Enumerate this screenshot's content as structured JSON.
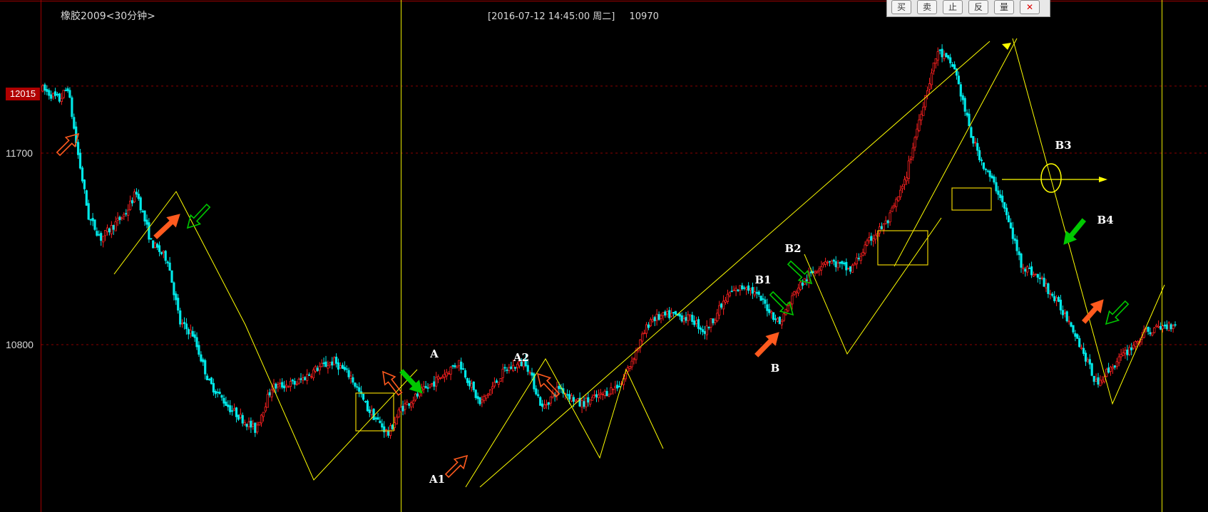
{
  "header": {
    "title": "橡胶2009<30分钟>",
    "datetime": "[2016-07-12  14:45:00 周二]",
    "price": "10970"
  },
  "toolbar": {
    "buttons": [
      {
        "label": "买",
        "icon": "buy-button"
      },
      {
        "label": "卖",
        "icon": "sell-button"
      },
      {
        "label": "止",
        "icon": "stop-button"
      },
      {
        "label": "反",
        "icon": "reverse-button"
      },
      {
        "label": "量",
        "icon": "volume-button"
      },
      {
        "label": "✕",
        "icon": "close-icon"
      }
    ]
  },
  "price_tag": "12015",
  "y_axis_labels": [
    "11700",
    "10800"
  ],
  "colors": {
    "up": "#ff2020",
    "down": "#00e8e8",
    "trend": "#ffff00",
    "grid": "#8b0000",
    "green_arrow": "#00c800",
    "orange_arrow": "#ff5a1e"
  },
  "chart_data": {
    "type": "candlestick",
    "symbol": "橡胶2009",
    "interval": "30分钟",
    "ylim": [
      10200,
      12400
    ],
    "price_levels": [
      12015,
      11700,
      10800
    ],
    "approx_close_path": [
      [
        0,
        12000
      ],
      [
        8,
        11950
      ],
      [
        12,
        12010
      ],
      [
        16,
        11750
      ],
      [
        22,
        11400
      ],
      [
        28,
        11300
      ],
      [
        40,
        11420
      ],
      [
        45,
        11520
      ],
      [
        52,
        11280
      ],
      [
        60,
        11200
      ],
      [
        66,
        10900
      ],
      [
        72,
        10850
      ],
      [
        80,
        10620
      ],
      [
        90,
        10500
      ],
      [
        102,
        10400
      ],
      [
        110,
        10600
      ],
      [
        122,
        10620
      ],
      [
        132,
        10690
      ],
      [
        140,
        10720
      ],
      [
        148,
        10650
      ],
      [
        156,
        10500
      ],
      [
        166,
        10380
      ],
      [
        172,
        10500
      ],
      [
        185,
        10600
      ],
      [
        195,
        10680
      ],
      [
        200,
        10720
      ],
      [
        210,
        10520
      ],
      [
        222,
        10680
      ],
      [
        232,
        10720
      ],
      [
        240,
        10500
      ],
      [
        248,
        10600
      ],
      [
        258,
        10520
      ],
      [
        268,
        10560
      ],
      [
        278,
        10620
      ],
      [
        292,
        10920
      ],
      [
        302,
        10940
      ],
      [
        312,
        10920
      ],
      [
        318,
        10860
      ],
      [
        330,
        11040
      ],
      [
        338,
        11080
      ],
      [
        346,
        11000
      ],
      [
        354,
        10900
      ],
      [
        362,
        11060
      ],
      [
        376,
        11200
      ],
      [
        388,
        11150
      ],
      [
        398,
        11300
      ],
      [
        406,
        11380
      ],
      [
        414,
        11560
      ],
      [
        422,
        11900
      ],
      [
        430,
        12180
      ],
      [
        438,
        12100
      ],
      [
        446,
        11780
      ],
      [
        452,
        11640
      ],
      [
        460,
        11500
      ],
      [
        470,
        11180
      ],
      [
        480,
        11100
      ],
      [
        494,
        10900
      ],
      [
        506,
        10620
      ],
      [
        518,
        10740
      ],
      [
        530,
        10860
      ],
      [
        544,
        10900
      ]
    ],
    "annotations": [
      "A",
      "A1",
      "A2",
      "B",
      "B1",
      "B2",
      "B3",
      "B4"
    ]
  }
}
